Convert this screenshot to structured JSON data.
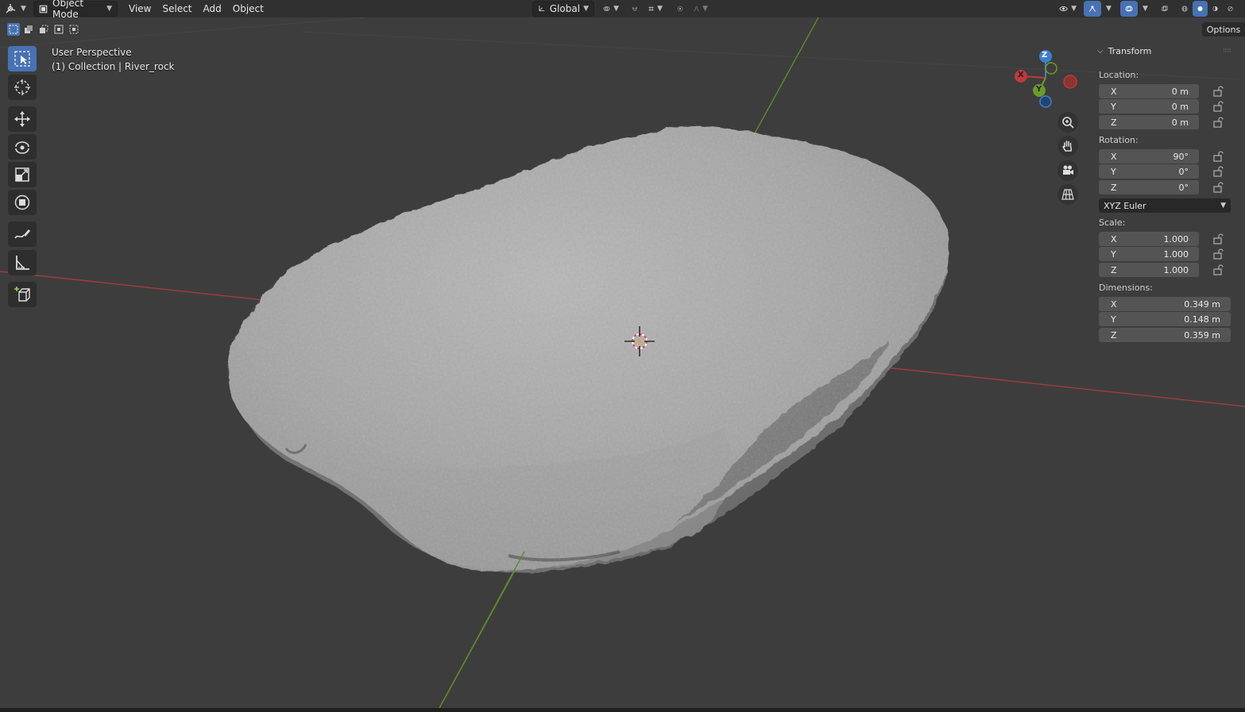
{
  "header": {
    "editor_type_icon": "3d-viewport-icon",
    "mode": "Object Mode",
    "menus": [
      "View",
      "Select",
      "Add",
      "Object"
    ],
    "transform_orientation": "Global",
    "right_icons": [
      "visibility-icon",
      "gizmo-icon",
      "overlay-icon",
      "xray-icon",
      "wireframe-shading-icon",
      "solid-shading-icon",
      "material-shading-icon",
      "rendered-shading-icon"
    ]
  },
  "viewport": {
    "perspective_label": "User Perspective",
    "collection_label": "(1) Collection | River_rock",
    "options_label": "Options"
  },
  "gizmo": {
    "x": "X",
    "y": "Y",
    "z": "Z"
  },
  "toolbar": [
    "select-box-icon",
    "cursor-icon",
    "move-icon",
    "rotate-icon",
    "scale-icon",
    "transform-icon",
    "annotate-icon",
    "measure-icon",
    "add-cube-icon"
  ],
  "panel": {
    "title": "Transform",
    "location_label": "Location:",
    "location": [
      {
        "axis": "X",
        "value": "0 m"
      },
      {
        "axis": "Y",
        "value": "0 m"
      },
      {
        "axis": "Z",
        "value": "0 m"
      }
    ],
    "rotation_label": "Rotation:",
    "rotation": [
      {
        "axis": "X",
        "value": "90°"
      },
      {
        "axis": "Y",
        "value": "0°"
      },
      {
        "axis": "Z",
        "value": "0°"
      }
    ],
    "rotation_mode": "XYZ Euler",
    "scale_label": "Scale:",
    "scale": [
      {
        "axis": "X",
        "value": "1.000"
      },
      {
        "axis": "Y",
        "value": "1.000"
      },
      {
        "axis": "Z",
        "value": "1.000"
      }
    ],
    "dimensions_label": "Dimensions:",
    "dimensions": [
      {
        "axis": "X",
        "value": "0.349 m"
      },
      {
        "axis": "Y",
        "value": "0.148 m"
      },
      {
        "axis": "Z",
        "value": "0.359 m"
      }
    ]
  },
  "colors": {
    "background": "#3d3d3d",
    "header": "#303030",
    "accent": "#4772b3",
    "x_axis": "#c0393b",
    "y_axis": "#6a9a28",
    "z_axis": "#3c7fd0",
    "rock": "#9a9a9a"
  }
}
